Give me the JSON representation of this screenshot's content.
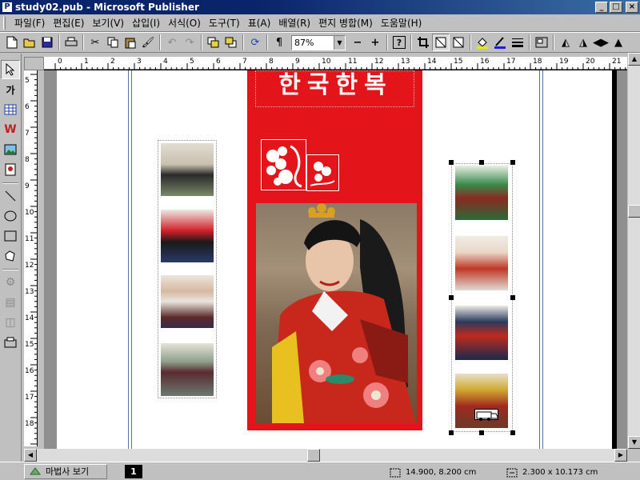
{
  "window": {
    "title": "study02.pub - Microsoft Publisher",
    "min_glyph": "_",
    "max_glyph": "□",
    "close_glyph": "×"
  },
  "menu": [
    {
      "label": "파일(F)"
    },
    {
      "label": "편집(E)"
    },
    {
      "label": "보기(V)"
    },
    {
      "label": "삽입(I)"
    },
    {
      "label": "서식(O)"
    },
    {
      "label": "도구(T)"
    },
    {
      "label": "표(A)"
    },
    {
      "label": "배열(R)"
    },
    {
      "label": "편지 병합(M)"
    },
    {
      "label": "도움말(H)"
    }
  ],
  "toolbar": {
    "zoom_value": "87%",
    "zoom_out_label": "−",
    "zoom_in_label": "+",
    "help_label": "?",
    "paragraph_label": "¶"
  },
  "palette": {
    "text_tool_label": "가"
  },
  "rulers": {
    "horizontal": [
      "0",
      "1",
      "2",
      "3",
      "4",
      "5",
      "6",
      "7",
      "8",
      "9",
      "10",
      "11",
      "12",
      "13",
      "14",
      "15",
      "16",
      "17",
      "18",
      "19",
      "20",
      "21"
    ],
    "vertical": [
      "5",
      "6",
      "7",
      "8",
      "9",
      "10",
      "11",
      "12",
      "13",
      "14",
      "15",
      "16",
      "17",
      "18"
    ]
  },
  "document": {
    "banner_text": "한국한복"
  },
  "status": {
    "wizard_label": "마법사 보기",
    "page_number": "1",
    "position": "14.900, 8.200 cm",
    "size": "2.300 x  10.173 cm"
  },
  "colors": {
    "title_bar": "#0a246a",
    "red_panel": "#e4141b",
    "guide": "#5a6fa8"
  }
}
